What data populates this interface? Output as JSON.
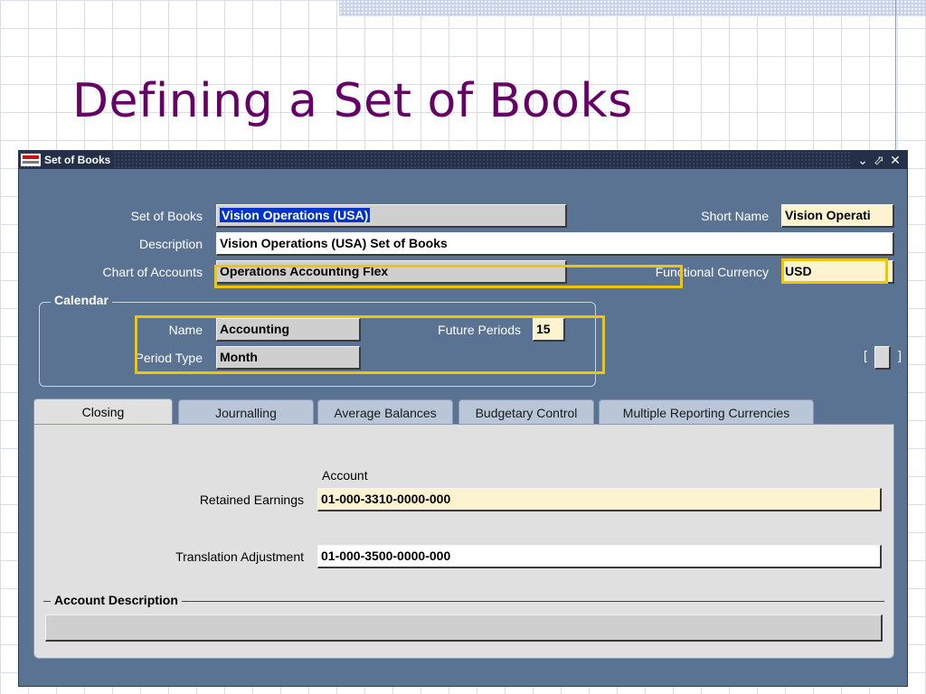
{
  "slide": {
    "title": "Defining a Set of Books"
  },
  "window": {
    "title": "Set of Books",
    "controls": {
      "minimize": "⌄",
      "maximize": "⬀",
      "close": "✕"
    }
  },
  "form": {
    "set_of_books": {
      "label": "Set of Books",
      "value": "Vision Operations (USA)"
    },
    "short_name": {
      "label": "Short Name",
      "value": "Vision Operati"
    },
    "description": {
      "label": "Description",
      "value": "Vision Operations (USA) Set of Books"
    },
    "chart_of_accounts": {
      "label": "Chart of Accounts",
      "value": "Operations Accounting Flex"
    },
    "functional_currency": {
      "label": "Functional Currency",
      "value": "USD"
    },
    "calendar": {
      "title": "Calendar",
      "name": {
        "label": "Name",
        "value": "Accounting"
      },
      "future_periods": {
        "label": "Future Periods",
        "value": "15"
      },
      "period_type": {
        "label": "Period Type",
        "value": "Month"
      }
    },
    "bracket_left": "[",
    "bracket_right": "]"
  },
  "tabs": [
    {
      "label": "Closing",
      "active": true
    },
    {
      "label": "Journalling",
      "active": false
    },
    {
      "label": "Average Balances",
      "active": false
    },
    {
      "label": "Budgetary Control",
      "active": false
    },
    {
      "label": "Multiple Reporting Currencies",
      "active": false
    }
  ],
  "closing": {
    "account_header": "Account",
    "retained_earnings": {
      "label": "Retained Earnings",
      "value": "01-000-3310-0000-000"
    },
    "translation_adjustment": {
      "label": "Translation Adjustment",
      "value": "01-000-3500-0000-000"
    },
    "account_description": {
      "title": "Account Description",
      "value": ""
    }
  },
  "colors": {
    "title": "#660066",
    "highlight": "#f2c500",
    "window_bg": "#5a7393",
    "required_field": "#fdf3cf"
  }
}
